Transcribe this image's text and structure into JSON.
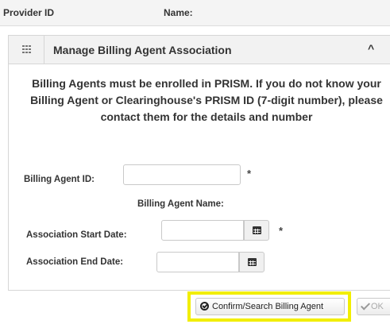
{
  "header": {
    "provider_id_label": "Provider ID",
    "name_label": "Name:"
  },
  "panel": {
    "title": "Manage Billing Agent Association",
    "grid_icon": "grid-icon",
    "collapse_icon": "chevron-up-icon",
    "collapse_glyph": "^",
    "notice": "Billing Agents must be enrolled in PRISM. If you do not know your Billing Agent or Clearinghouse's PRISM ID (7-digit number), please contact them for the details and number"
  },
  "form": {
    "billing_agent_id_label": "Billing Agent ID:",
    "billing_agent_id_value": "",
    "billing_agent_name_label": "Billing Agent Name:",
    "start_date_label": "Association Start Date:",
    "start_date_value": "",
    "end_date_label": "Association End Date:",
    "end_date_value": "",
    "required_marker": "*",
    "calendar_icon": "calendar-icon"
  },
  "actions": {
    "confirm_label": "Confirm/Search Billing Agent",
    "confirm_icon": "check-circle-icon",
    "ok_label": "OK",
    "ok_icon": "checkmark-icon",
    "highlight_color": "#f2ee00"
  }
}
